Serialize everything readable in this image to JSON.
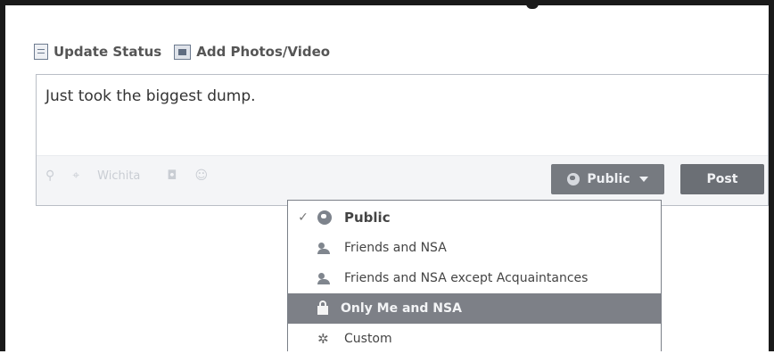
{
  "composer": {
    "tabs": [
      {
        "label": "Update Status",
        "icon": "status-icon"
      },
      {
        "label": "Add Photos/Video",
        "icon": "photo-icon"
      }
    ],
    "text": "Just took the biggest dump.",
    "with_label": "Wichita",
    "audience_label": "Public",
    "post_label": "Post"
  },
  "audience_menu": {
    "items": [
      {
        "label": "Public",
        "icon": "globe-icon",
        "checked": true
      },
      {
        "label": "Friends and NSA",
        "icon": "friends-icon",
        "checked": false
      },
      {
        "label": "Friends and NSA except Acquaintances",
        "icon": "friends-except-icon",
        "checked": false
      },
      {
        "label": "Only Me and NSA",
        "icon": "lock-icon",
        "checked": false,
        "highlighted": true
      },
      {
        "label": "Custom",
        "icon": "gear-icon",
        "checked": false
      }
    ]
  },
  "colors": {
    "highlight": "#7d8087",
    "button": "#6b6f75"
  }
}
